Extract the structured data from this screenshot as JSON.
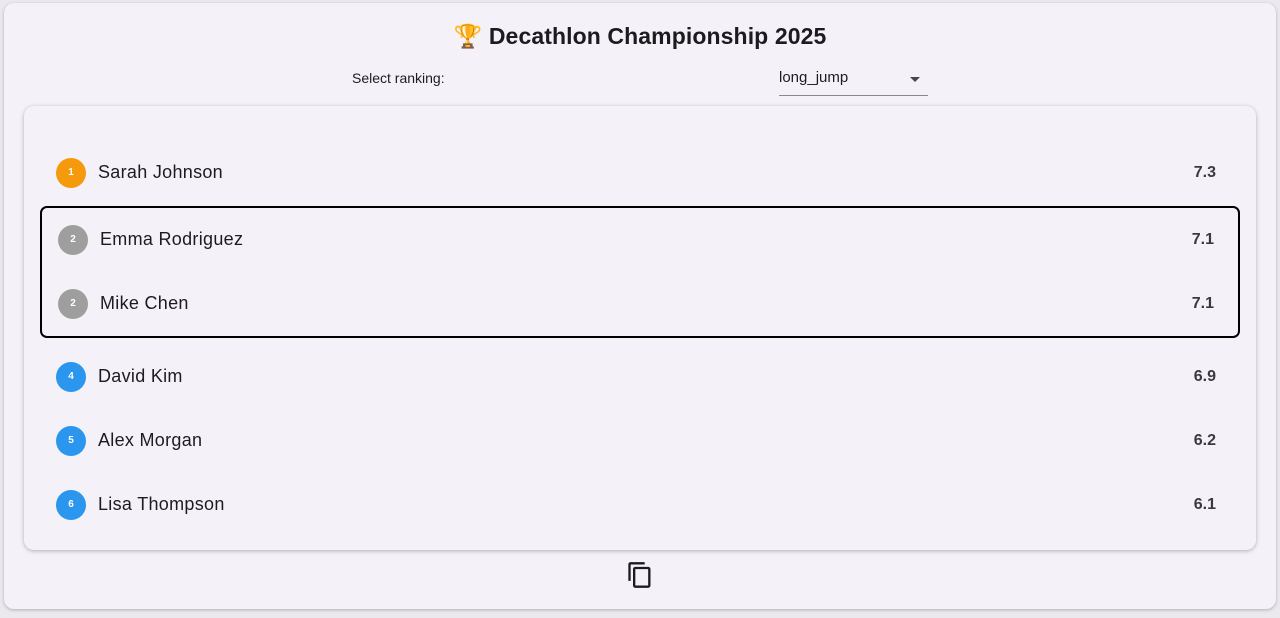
{
  "header": {
    "trophy_icon": "🏆",
    "title": "Decathlon Championship 2025"
  },
  "ranking_select": {
    "label": "Select ranking:",
    "value": "long_jump"
  },
  "colors": {
    "gold": "#f59a0c",
    "silver": "#9e9e9e",
    "default": "#2b96ee"
  },
  "rankings": [
    {
      "rank": "1",
      "name": "Sarah Johnson",
      "score": "7.3"
    },
    {
      "rank": "2",
      "name": "Emma Rodriguez",
      "score": "7.1"
    },
    {
      "rank": "2",
      "name": "Mike Chen",
      "score": "7.1"
    },
    {
      "rank": "4",
      "name": "David Kim",
      "score": "6.9"
    },
    {
      "rank": "5",
      "name": "Alex Morgan",
      "score": "6.2"
    },
    {
      "rank": "6",
      "name": "Lisa Thompson",
      "score": "6.1"
    }
  ],
  "actions": {
    "copy_icon": "copy-icon"
  }
}
